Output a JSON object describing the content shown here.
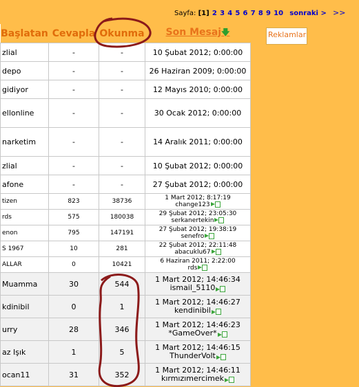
{
  "pager": {
    "label": "Sayfa:",
    "current": "[1]",
    "pages": [
      "2",
      "3",
      "4",
      "5",
      "6",
      "7",
      "8",
      "9",
      "10"
    ],
    "next": "sonraki >",
    "last": ">>"
  },
  "ads": {
    "label": "Reklamlar"
  },
  "table": {
    "headers": {
      "started_by": "Başlatan",
      "replies": "Cevapla",
      "views": "Okunma",
      "last_post": "Son Mesaj"
    },
    "rows": [
      {
        "topic": "zlial",
        "replies": "-",
        "views": "-",
        "last": "10 Şubat 2012; 0:00:00",
        "by": ""
      },
      {
        "topic": "depo",
        "replies": "-",
        "views": "-",
        "last": "26 Haziran 2009; 0:00:00",
        "by": ""
      },
      {
        "topic": "gidiyor",
        "replies": "-",
        "views": "-",
        "last": "12 Mayıs 2010; 0:00:00",
        "by": ""
      },
      {
        "topic": "ellonline",
        "replies": "-",
        "views": "-",
        "last": "30 Ocak 2012; 0:00:00",
        "by": ""
      },
      {
        "topic": "narketim",
        "replies": "-",
        "views": "-",
        "last": "14 Aralık 2011; 0:00:00",
        "by": ""
      },
      {
        "topic": "zlial",
        "replies": "-",
        "views": "-",
        "last": "10 Şubat 2012; 0:00:00",
        "by": ""
      },
      {
        "topic": "afone",
        "replies": "-",
        "views": "-",
        "last": "27 Şubat 2012; 0:00:00",
        "by": ""
      },
      {
        "topic": "tizen",
        "replies": "823",
        "views": "38736",
        "last": "1 Mart 2012; 8:17:19",
        "by": "change123"
      },
      {
        "topic": "rds",
        "replies": "575",
        "views": "180038",
        "last": "29 Şubat 2012; 23:05:30",
        "by": "serkanertekin"
      },
      {
        "topic": "enon",
        "replies": "795",
        "views": "147191",
        "last": "27 Şubat 2012; 19:38:19",
        "by": "senefro"
      },
      {
        "topic": "S 1967",
        "replies": "10",
        "views": "281",
        "last": "22 Şubat 2012; 22:11:48",
        "by": "abacuklu67"
      },
      {
        "topic": "ALLAR",
        "replies": "0",
        "views": "10421",
        "last": "6 Haziran 2011; 2:22:00",
        "by": "rds"
      },
      {
        "topic": "Muamma",
        "replies": "30",
        "views": "544",
        "last": "1 Mart 2012; 14:46:34",
        "by": "ismail_5110"
      },
      {
        "topic": "kdinibil",
        "replies": "0",
        "views": "1",
        "last": "1 Mart 2012; 14:46:27",
        "by": "kendinibil"
      },
      {
        "topic": "urry",
        "replies": "28",
        "views": "346",
        "last": "1 Mart 2012; 14:46:23",
        "by": "*GameOver*"
      },
      {
        "topic": "az Işık",
        "replies": "1",
        "views": "5",
        "last": "1 Mart 2012; 14:46:15",
        "by": "ThunderVolt"
      },
      {
        "topic": "ocan11",
        "replies": "31",
        "views": "352",
        "last": "1 Mart 2012; 14:46:11",
        "by": "kırmızımercimek"
      }
    ]
  },
  "colors": {
    "background": "#FFBD4A",
    "header_text": "#E06C0A",
    "link": "#0000CC",
    "annotation": "#8B1A1A",
    "go_icon": "#3BA53B"
  },
  "icons": {
    "sort_arrow": "arrow-down-icon",
    "go_last": "go-to-last-post-icon"
  }
}
